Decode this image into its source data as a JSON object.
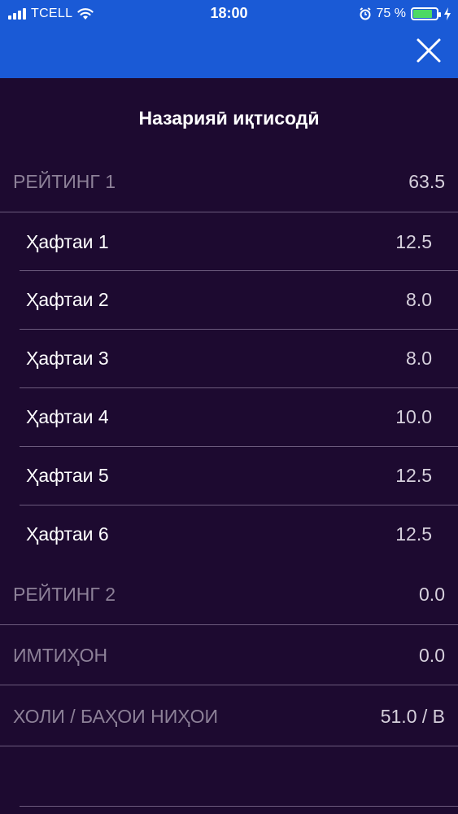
{
  "status_bar": {
    "carrier": "TCELL",
    "time": "18:00",
    "battery_percent": "75 %",
    "battery_level": 0.75
  },
  "nav": {
    "close_icon": "close-icon"
  },
  "title": "Назарияӣ иқтисодӣ",
  "rating1": {
    "label": "РЕЙТИНГ 1",
    "value": "63.5"
  },
  "weeks": [
    {
      "label": "Ҳафтаи 1",
      "value": "12.5"
    },
    {
      "label": "Ҳафтаи 2",
      "value": "8.0"
    },
    {
      "label": "Ҳафтаи 3",
      "value": "8.0"
    },
    {
      "label": "Ҳафтаи 4",
      "value": "10.0"
    },
    {
      "label": "Ҳафтаи 5",
      "value": "12.5"
    },
    {
      "label": "Ҳафтаи 6",
      "value": "12.5"
    }
  ],
  "rating2": {
    "label": "РЕЙТИНГ 2",
    "value": "0.0"
  },
  "exam": {
    "label": "ИМТИҲОН",
    "value": "0.0"
  },
  "final": {
    "label": "ХОЛИ / БАҲОИ НИҲОИ",
    "value": "51.0 / B"
  },
  "colors": {
    "header": "#1a5ad6",
    "background": "#1d0a30",
    "battery": "#4cd964"
  }
}
